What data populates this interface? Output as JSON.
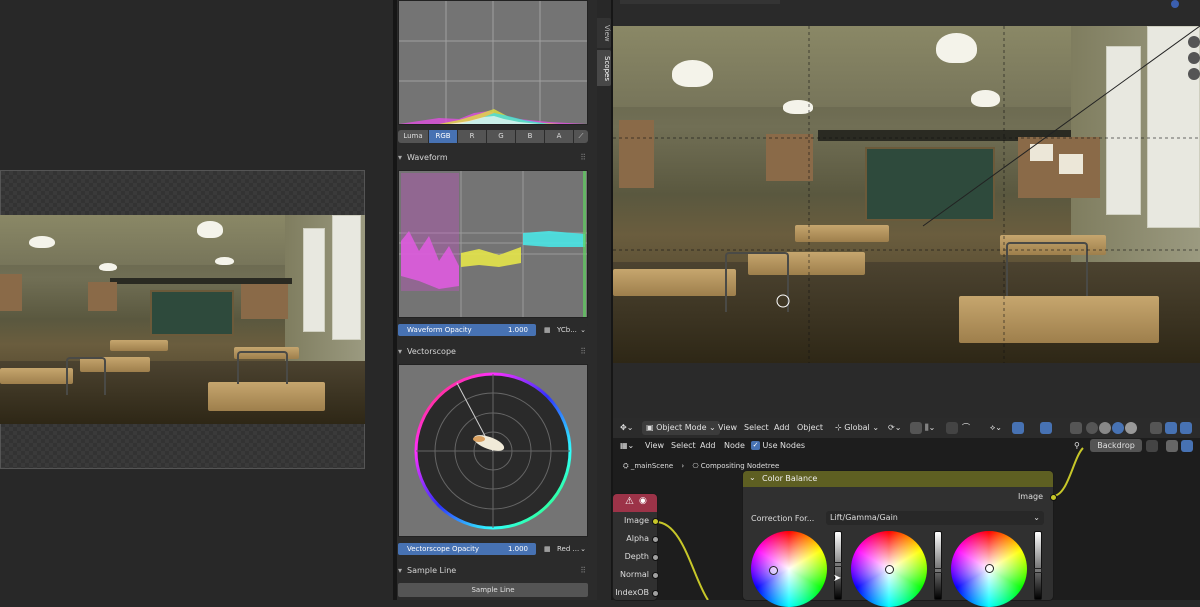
{
  "scopes": {
    "histogram_modes": [
      "Luma",
      "RGB",
      "R",
      "G",
      "B",
      "A"
    ],
    "histogram_active": "RGB",
    "waveform": {
      "title": "Waveform",
      "opacity_label": "Waveform Opacity",
      "opacity_value": "1.000",
      "mode": "YCb..."
    },
    "vectorscope": {
      "title": "Vectorscope",
      "opacity_label": "Vectorscope Opacity",
      "opacity_value": "1.000",
      "mode": "Red ..."
    },
    "sample_line": {
      "title": "Sample Line",
      "button": "Sample Line"
    }
  },
  "side_tabs": [
    "View",
    "Scopes"
  ],
  "viewport_header": {
    "mode": "Object Mode",
    "menu": [
      "View",
      "Select",
      "Add",
      "Object"
    ],
    "orientation": "Global"
  },
  "node_header": {
    "menu": [
      "View",
      "Select",
      "Add",
      "Node"
    ],
    "use_nodes": "Use Nodes",
    "backdrop": "Backdrop"
  },
  "breadcrumb": {
    "scene": "_mainScene",
    "tree": "Compositing Nodetree"
  },
  "render_layers_node": {
    "outputs": [
      "Image",
      "Alpha",
      "Depth",
      "Normal",
      "IndexOB"
    ]
  },
  "color_balance_node": {
    "title": "Color Balance",
    "output": "Image",
    "correction_label": "Correction For...",
    "correction_value": "Lift/Gamma/Gain"
  },
  "colors": {
    "accent": "#4772b3",
    "node_header": "#5e5f22",
    "error_header": "#9c3348"
  }
}
